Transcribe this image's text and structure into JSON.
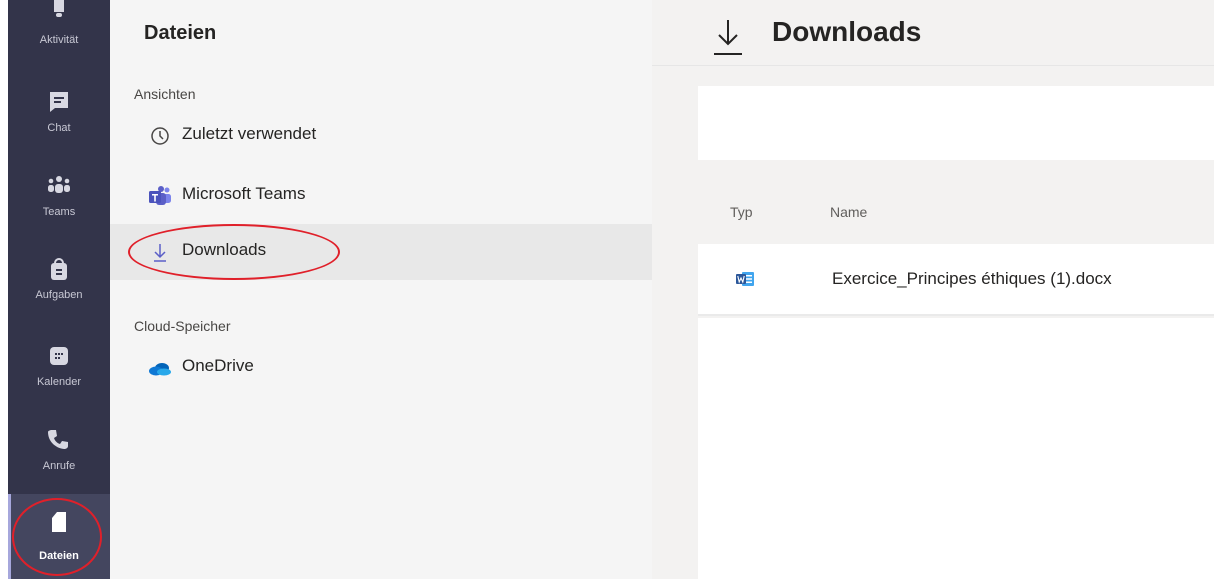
{
  "rail": {
    "items": [
      {
        "label": "Aktivität",
        "icon": "bell-icon"
      },
      {
        "label": "Chat",
        "icon": "chat-icon"
      },
      {
        "label": "Teams",
        "icon": "teams-icon"
      },
      {
        "label": "Aufgaben",
        "icon": "assignments-icon"
      },
      {
        "label": "Kalender",
        "icon": "calendar-icon"
      },
      {
        "label": "Anrufe",
        "icon": "phone-icon"
      },
      {
        "label": "Dateien",
        "icon": "file-icon",
        "active": true
      }
    ]
  },
  "files_panel": {
    "title": "Dateien",
    "views_label": "Ansichten",
    "views": [
      {
        "label": "Zuletzt verwendet",
        "icon": "clock-icon"
      },
      {
        "label": "Microsoft Teams",
        "icon": "teams-logo-icon"
      },
      {
        "label": "Downloads",
        "icon": "download-icon",
        "selected": true
      }
    ],
    "cloud_label": "Cloud-Speicher",
    "cloud": [
      {
        "label": "OneDrive",
        "icon": "onedrive-icon"
      }
    ]
  },
  "main": {
    "title": "Downloads",
    "title_icon": "download-icon",
    "columns": {
      "type": "Typ",
      "name": "Name"
    },
    "files": [
      {
        "type_icon": "word-icon",
        "name": "Exercice_Principes éthiques (1).docx"
      }
    ]
  },
  "colors": {
    "rail_bg": "#33344a",
    "panel_bg": "#f5f5f5",
    "highlight": "#e0202a",
    "word_blue": "#2b579a",
    "teams_purple": "#5b5fc7",
    "onedrive_blue": "#0f78d4"
  }
}
